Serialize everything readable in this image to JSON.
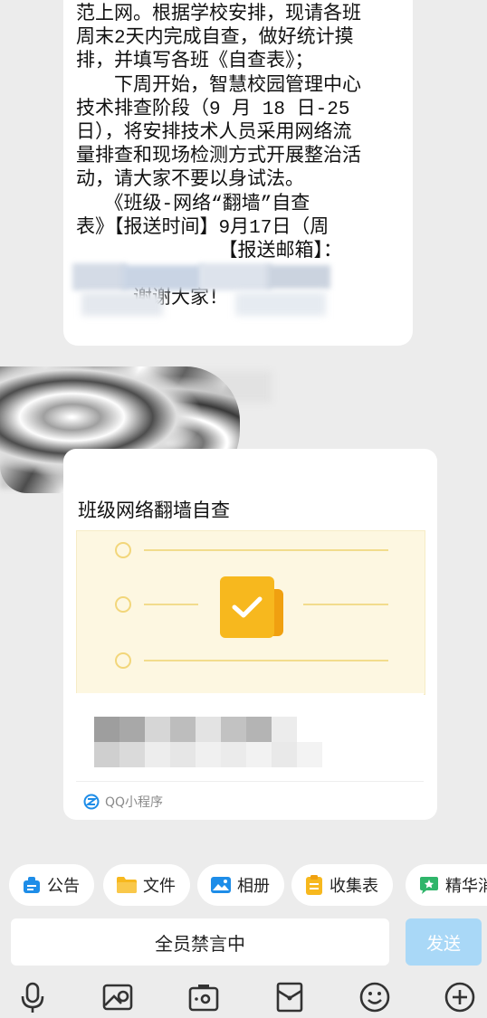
{
  "message": {
    "lines": [
      "范上网。根据学校安排，现请各班",
      "周末2天内完成自查，做好统计摸",
      "排，并填写各班《自查表》；",
      "　　下周开始，智慧校园管理中心",
      "技术排查阶段（9 月 18 日-25",
      "日），将安排技术人员采用网络流",
      "量排查和现场检测方式开展整治活",
      "动，请大家不要以身试法。",
      "　　《班级-网络“翻墙”自查",
      "表》【报送时间】9月17日（周",
      "　　　　　　　　【报送邮箱】：",
      "",
      "　　　谢谢大家！"
    ]
  },
  "card": {
    "title": "班级网络翻墙自查",
    "footer": "QQ小程序"
  },
  "chips": [
    "公告",
    "文件",
    "相册",
    "收集表",
    "精华消"
  ],
  "input": {
    "status": "全员禁言中",
    "send_label": "发送"
  },
  "colors": {
    "send_disabled": "#a9d8f7",
    "accent_blue": "#1e8de8",
    "card_preview_bg": "#fdf7e1",
    "check_yellow": "#f7b81e"
  },
  "icons": {
    "toolbar": [
      "microphone-icon",
      "image-icon",
      "camera-icon",
      "red-packet-icon",
      "emoji-icon",
      "plus-icon"
    ]
  }
}
